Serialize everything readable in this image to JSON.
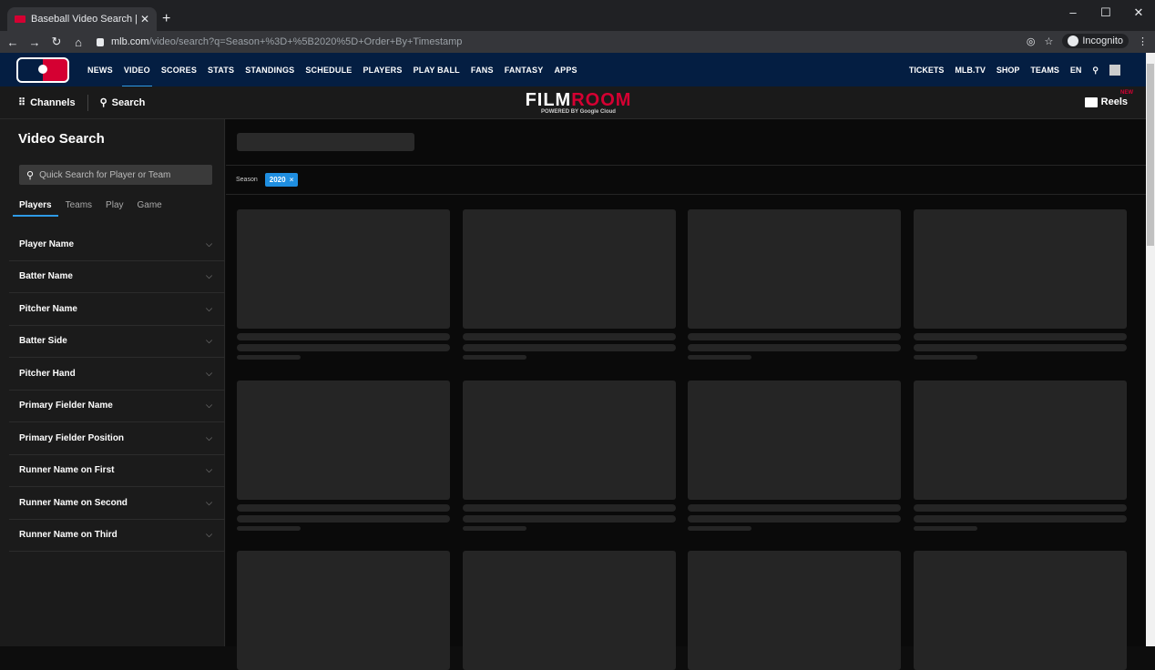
{
  "browser": {
    "tab_title": "Baseball Video Search | MLB Film",
    "url_domain": "mlb.com",
    "url_path": "/video/search?q=Season+%3D+%5B2020%5D+Order+By+Timestamp",
    "incognito_label": "Incognito"
  },
  "top_nav": {
    "items": [
      "NEWS",
      "VIDEO",
      "SCORES",
      "STATS",
      "STANDINGS",
      "SCHEDULE",
      "PLAYERS",
      "PLAY BALL",
      "FANS",
      "FANTASY",
      "APPS"
    ],
    "right_items": [
      "TICKETS",
      "MLB.TV",
      "SHOP",
      "TEAMS",
      "EN"
    ]
  },
  "subnav": {
    "channels_label": "Channels",
    "search_label": "Search",
    "logo_film": "FILM",
    "logo_room": "ROOM",
    "logo_powered": "POWERED BY Google Cloud",
    "reels_label": "Reels",
    "new_badge": "NEW"
  },
  "sidebar": {
    "title": "Video Search",
    "search_placeholder": "Quick Search for Player or Team",
    "tabs": [
      "Players",
      "Teams",
      "Play",
      "Game"
    ],
    "filters": [
      "Player Name",
      "Batter Name",
      "Pitcher Name",
      "Batter Side",
      "Pitcher Hand",
      "Primary Fielder Name",
      "Primary Fielder Position",
      "Runner Name on First",
      "Runner Name on Second",
      "Runner Name on Third"
    ]
  },
  "main": {
    "season_label": "Season",
    "season_chip": "2020",
    "chip_close": "×"
  },
  "colors": {
    "accent": "#1f8ee0",
    "mlb_navy": "#041e42",
    "mlb_red": "#d50032"
  }
}
